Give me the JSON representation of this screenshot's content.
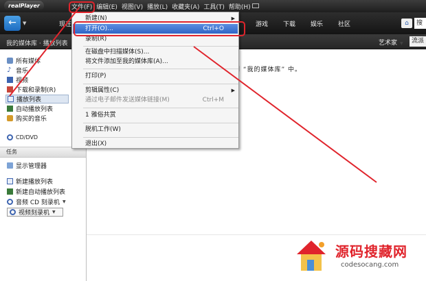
{
  "app": {
    "logo_text": "realPlayer"
  },
  "menubar": {
    "items": [
      "文件(F)",
      "编辑(E)",
      "视图(V)",
      "播放(L)",
      "收藏夹(A)",
      "工具(T)",
      "帮助(H)"
    ]
  },
  "navbar": {
    "now_label": "现在",
    "tabs": [
      "游戏",
      "下载",
      "娱乐",
      "社区"
    ],
    "search_text": "搜"
  },
  "subbar": {
    "breadcrumb": "我的媒体库 · 播放列表",
    "artist_label": "艺术家",
    "stream_label": "流派"
  },
  "sidebar": {
    "items": [
      {
        "label": "所有媒体",
        "icon": "media-icon"
      },
      {
        "label": "音乐",
        "icon": "music-icon"
      },
      {
        "label": "视频",
        "icon": "video-icon"
      },
      {
        "label": "下载和录制(R)",
        "icon": "download-icon"
      },
      {
        "label": "播放列表",
        "icon": "playlist-icon",
        "selected": true
      },
      {
        "label": "自动播放列表",
        "icon": "auto-playlist-icon"
      },
      {
        "label": "购买的音乐",
        "icon": "purchased-music-icon"
      },
      {
        "label": "CD/DVD",
        "icon": "cd-icon"
      }
    ],
    "tasks_header": "任务",
    "tasks": [
      {
        "label": "显示管理器",
        "icon": "folder-icon"
      },
      {
        "label": "新建播放列表",
        "icon": "new-playlist-icon"
      },
      {
        "label": "新建自动播放列表",
        "icon": "new-auto-playlist-icon"
      },
      {
        "label": "音频 CD 刻录机",
        "icon": "burn-icon",
        "dropdown": true
      },
      {
        "label": "视频刻录机",
        "icon": "video-burn-icon",
        "dropdown": true
      }
    ]
  },
  "main": {
    "message": "到 “我的媒体库” 中。"
  },
  "file_menu": {
    "items": [
      {
        "label": "新建(N)",
        "shortcut": "",
        "submenu": true
      },
      {
        "label": "打开(O)...",
        "shortcut": "Ctrl+O",
        "highlight": true
      },
      {
        "label": "录制(R)",
        "shortcut": ""
      },
      {
        "label": "在磁盘中扫描媒体(S)...",
        "shortcut": ""
      },
      {
        "label": "将文件添加至我的媒体库(A)...",
        "shortcut": ""
      },
      {
        "label": "打印(P)",
        "shortcut": ""
      },
      {
        "label": "剪辑属性(C)",
        "shortcut": "",
        "submenu": true
      },
      {
        "label": "通过电子邮件发送媒体链接(M)",
        "shortcut": "Ctrl+M",
        "disabled": true
      },
      {
        "label": "1 雅俗共赏",
        "shortcut": ""
      },
      {
        "label": "脱机工作(W)",
        "shortcut": ""
      },
      {
        "label": "退出(X)",
        "shortcut": ""
      }
    ]
  },
  "watermark": {
    "title": "源码搜藏网",
    "url": "codesocang.com"
  },
  "colors": {
    "annotation": "#e0242c",
    "highlight": "#2f64c6"
  }
}
